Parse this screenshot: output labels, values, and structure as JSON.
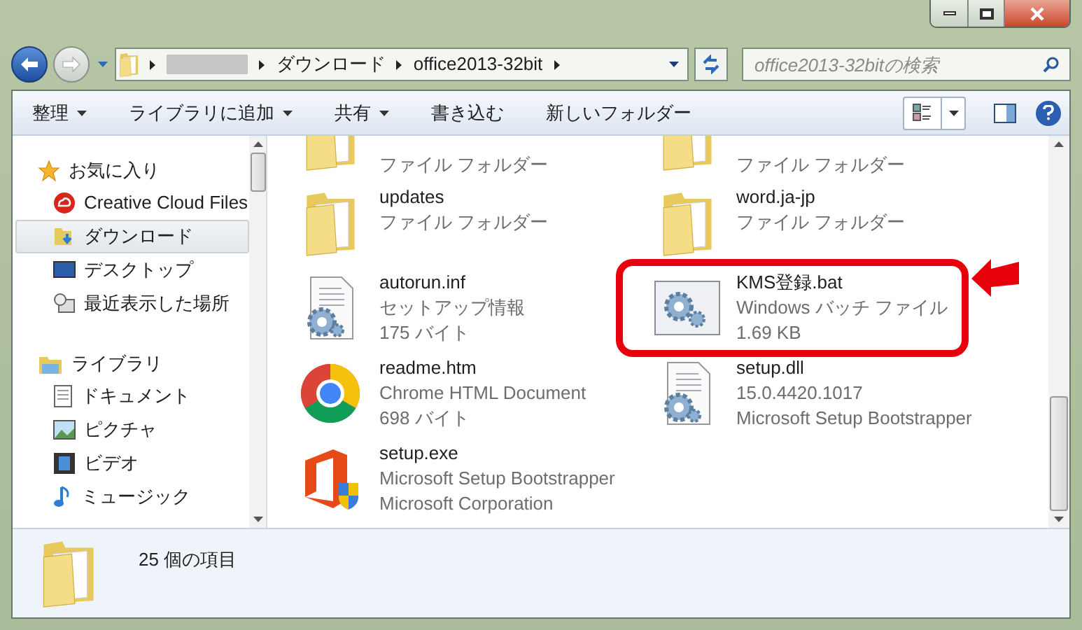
{
  "address": {
    "segments": [
      "ダウンロード",
      "office2013-32bit"
    ]
  },
  "search": {
    "placeholder": "office2013-32bitの検索"
  },
  "toolbar": {
    "items": [
      {
        "label": "整理",
        "dropdown": true
      },
      {
        "label": "ライブラリに追加",
        "dropdown": true
      },
      {
        "label": "共有",
        "dropdown": true
      },
      {
        "label": "書き込む",
        "dropdown": false
      },
      {
        "label": "新しいフォルダー",
        "dropdown": false
      }
    ]
  },
  "sidebar": {
    "groups": [
      {
        "label": "お気に入り",
        "kind": "favorites",
        "children": [
          {
            "label": "Creative Cloud Files",
            "kind": "cloud",
            "selected": false
          },
          {
            "label": "ダウンロード",
            "kind": "downloads",
            "selected": true
          },
          {
            "label": "デスクトップ",
            "kind": "desktop",
            "selected": false
          },
          {
            "label": "最近表示した場所",
            "kind": "recent",
            "selected": false
          }
        ]
      },
      {
        "label": "ライブラリ",
        "kind": "library",
        "children": [
          {
            "label": "ドキュメント",
            "kind": "documents",
            "selected": false
          },
          {
            "label": "ピクチャ",
            "kind": "pictures",
            "selected": false
          },
          {
            "label": "ビデオ",
            "kind": "videos",
            "selected": false
          },
          {
            "label": "ミュージック",
            "kind": "music",
            "selected": false
          }
        ]
      }
    ]
  },
  "files": [
    {
      "kind": "folder",
      "lines": [
        "ファイル フォルダー"
      ],
      "highlighted": false
    },
    {
      "kind": "folder",
      "lines": [
        "ファイル フォルダー"
      ],
      "highlighted": false
    },
    {
      "kind": "folder",
      "name": "updates",
      "lines": [
        "ファイル フォルダー"
      ],
      "highlighted": false
    },
    {
      "kind": "folder",
      "name": "word.ja-jp",
      "lines": [
        "ファイル フォルダー"
      ],
      "highlighted": false
    },
    {
      "kind": "setup-info",
      "name": "autorun.inf",
      "lines": [
        "セットアップ情報",
        "175 バイト"
      ],
      "highlighted": false
    },
    {
      "kind": "batch",
      "name": "KMS登録.bat",
      "lines": [
        "Windows バッチ ファイル",
        "1.69 KB"
      ],
      "highlighted": true
    },
    {
      "kind": "chrome",
      "name": "readme.htm",
      "lines": [
        "Chrome HTML Document",
        "698 バイト"
      ],
      "highlighted": false
    },
    {
      "kind": "dll",
      "name": "setup.dll",
      "lines": [
        "15.0.4420.1017",
        "Microsoft Setup Bootstrapper"
      ],
      "highlighted": false
    },
    {
      "kind": "office",
      "name": "setup.exe",
      "lines": [
        "Microsoft Setup Bootstrapper",
        "Microsoft Corporation"
      ],
      "highlighted": false
    }
  ],
  "status_bar": {
    "text": "25 個の項目"
  }
}
